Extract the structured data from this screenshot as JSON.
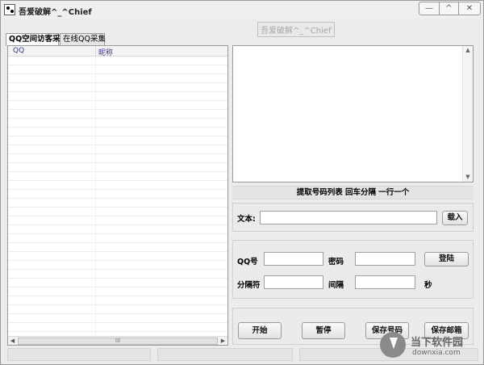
{
  "window": {
    "title": "吾爱破解^_^Chief",
    "watermark": "吾爱破解^_^Chief"
  },
  "window_controls": {
    "minimize": "—",
    "maximize": "^",
    "close": "✕"
  },
  "tabs": [
    {
      "label": "QQ空间访客采集",
      "active": true
    },
    {
      "label": "在线QQ采集",
      "active": false
    }
  ],
  "list": {
    "columns": [
      "QQ",
      "昵称"
    ],
    "rows": [],
    "hscroll_grip": "III"
  },
  "info_label": "提取号码列表 回车分隔  一行一个",
  "text_row": {
    "label": "文本:",
    "value": "",
    "load_button": "载入"
  },
  "login": {
    "qq_label": "QQ号",
    "qq_value": "",
    "password_label": "密码",
    "password_value": "",
    "login_button": "登陆",
    "separator_label": "分隔符",
    "separator_value": "",
    "interval_label": "间隔",
    "interval_value": "",
    "seconds_label": "秒"
  },
  "actions": {
    "start": "开始",
    "pause": "暂停",
    "save_numbers": "保存号码",
    "save_emails": "保存邮箱"
  },
  "site_logo": {
    "name": "当下软件园",
    "url": "downxia.com"
  }
}
